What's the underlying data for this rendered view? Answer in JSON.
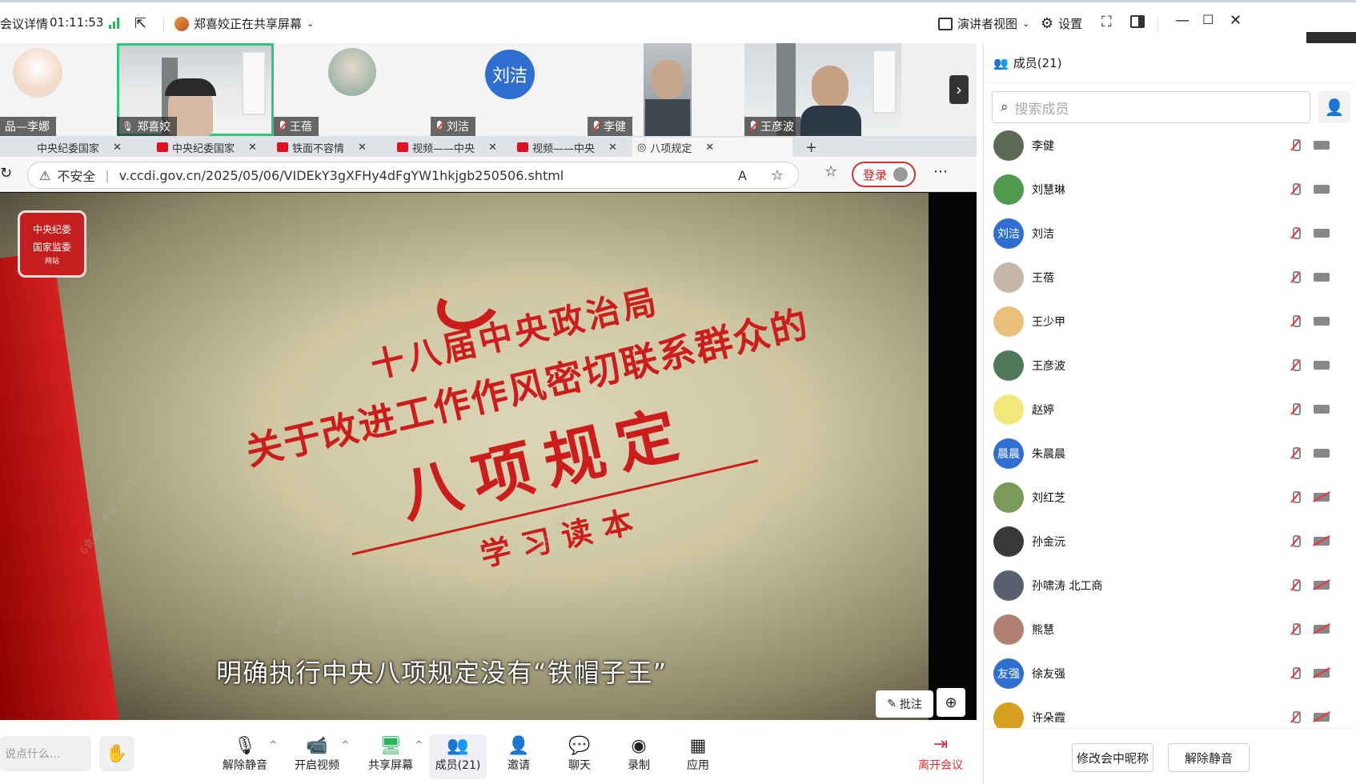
{
  "topbar": {
    "meeting_info": "会议详情",
    "timer": "01:11:53",
    "sharing": "郑喜姣正在共享屏幕",
    "presenter_view": "演讲者视图",
    "settings": "设置"
  },
  "strip": {
    "tiles": [
      {
        "name": "品—李娜"
      },
      {
        "name": "郑喜姣"
      },
      {
        "name": "王蓓"
      },
      {
        "name": "刘洁",
        "avatar_text": "刘洁"
      },
      {
        "name": "李健"
      },
      {
        "name": "王彦波"
      }
    ]
  },
  "browser": {
    "tabs": [
      "中央纪委国家",
      "中央纪委国家",
      "铁面不容情",
      "视频——中央",
      "视频——中央",
      "八项规定"
    ],
    "not_secure": "不安全",
    "url": "v.ccdi.gov.cn/2025/05/06/VIDEkY3gXFHy4dFgYW1hkjgb250506.shtml",
    "login": "登录"
  },
  "video": {
    "logo_line1": "中央纪委",
    "logo_line2": "国家监委",
    "logo_line3": "网站",
    "cover_line1": "十八届中央政治局",
    "cover_line2": "关于改进工作作风密切联系群众的",
    "cover_line3": "八项规定",
    "cover_line4": "学习读本",
    "subtitle": "明确执行中央八项规定没有“铁帽子王”",
    "annotate": "批注",
    "watermark": "6食品—李娜 +8613810728650"
  },
  "bottombar": {
    "say_placeholder": "说点什么...",
    "unmute": "解除静音",
    "start_video": "开启视频",
    "share_screen": "共享屏幕",
    "members": "成员(21)",
    "invite": "邀请",
    "chat": "聊天",
    "record": "录制",
    "apps": "应用",
    "leave": "离开会议"
  },
  "panel": {
    "title": "成员(21)",
    "search_placeholder": "搜索成员",
    "members": [
      {
        "name": "李健",
        "color": "#5a6a55",
        "text": "",
        "cam_off": false
      },
      {
        "name": "刘慧琳",
        "color": "#4f9a4f",
        "text": "",
        "cam_off": false
      },
      {
        "name": "刘洁",
        "color": "#2f6fd1",
        "text": "刘洁",
        "cam_off": false
      },
      {
        "name": "王蓓",
        "color": "#c7b7a8",
        "text": "",
        "cam_off": false
      },
      {
        "name": "王少甲",
        "color": "#e9c07a",
        "text": "",
        "cam_off": false
      },
      {
        "name": "王彦波",
        "color": "#4f7a5a",
        "text": "",
        "cam_off": false
      },
      {
        "name": "赵婷",
        "color": "#f2e87a",
        "text": "",
        "cam_off": false
      },
      {
        "name": "朱晨晨",
        "color": "#2f6fd1",
        "text": "晨晨",
        "cam_off": false
      },
      {
        "name": "刘红芝",
        "color": "#7a9a5a",
        "text": "",
        "cam_off": true
      },
      {
        "name": "孙金沅",
        "color": "#3a3a3a",
        "text": "",
        "cam_off": true
      },
      {
        "name": "孙啸涛 北工商",
        "color": "#5a6070",
        "text": "",
        "cam_off": true
      },
      {
        "name": "熊慧",
        "color": "#b08070",
        "text": "",
        "cam_off": true
      },
      {
        "name": "徐友强",
        "color": "#2f6fd1",
        "text": "友强",
        "cam_off": true
      },
      {
        "name": "许朵霞",
        "color": "#d8a020",
        "text": "",
        "cam_off": true
      }
    ],
    "rename": "修改会中昵称",
    "unmute_all": "解除静音"
  }
}
